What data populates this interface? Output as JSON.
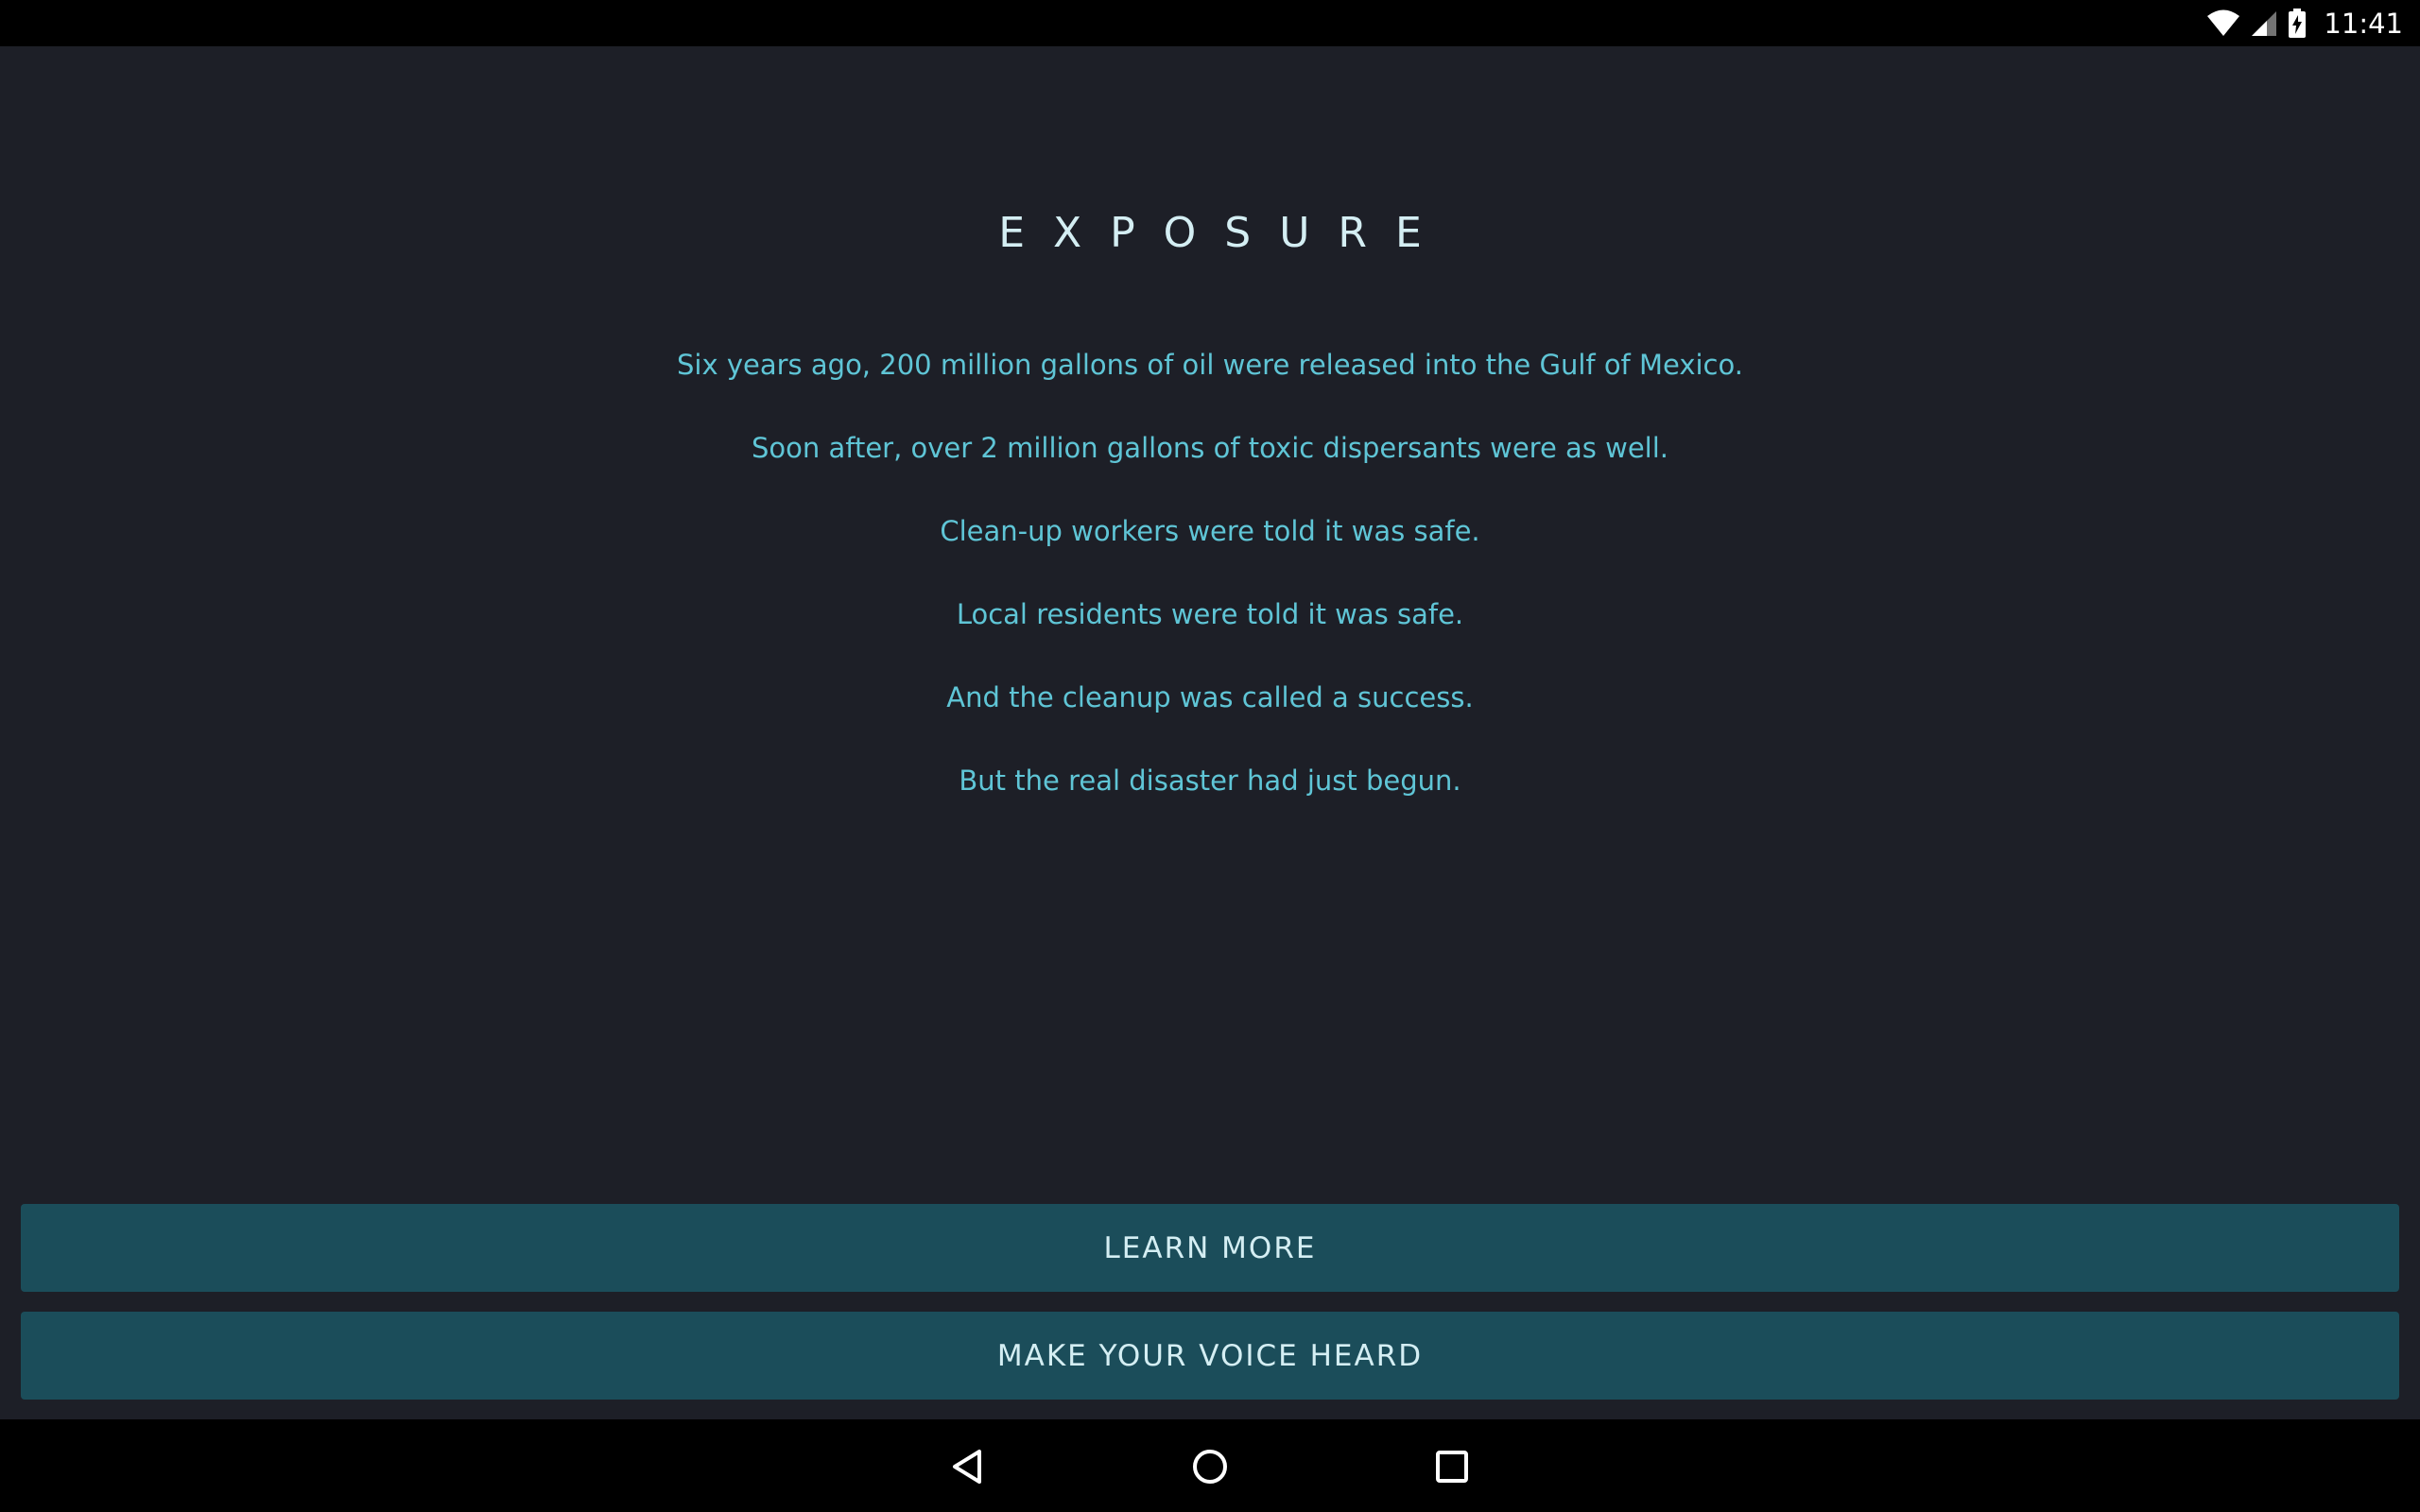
{
  "status_bar": {
    "time": "11:41",
    "icons": [
      "wifi-icon",
      "cell-signal-icon",
      "battery-charging-icon"
    ]
  },
  "main": {
    "title": "EXPOSURE",
    "paragraphs": [
      "Six years ago, 200 million gallons of oil were released into the Gulf of Mexico.",
      "Soon after, over 2 million gallons of toxic dispersants were as well.",
      "Clean-up workers were told it was safe.",
      "Local residents were told it was safe.",
      "And the cleanup was called a success.",
      "But the real disaster had just begun."
    ]
  },
  "buttons": {
    "learn_more": "LEARN MORE",
    "make_voice_heard": "MAKE YOUR VOICE HEARD"
  },
  "nav_bar": {
    "icons": [
      "back-icon",
      "home-icon",
      "recents-icon"
    ]
  },
  "colors": {
    "background": "#1d1f27",
    "text_accent": "#5fc5d6",
    "title": "#d4eef3",
    "button": "#1b4d5a"
  }
}
